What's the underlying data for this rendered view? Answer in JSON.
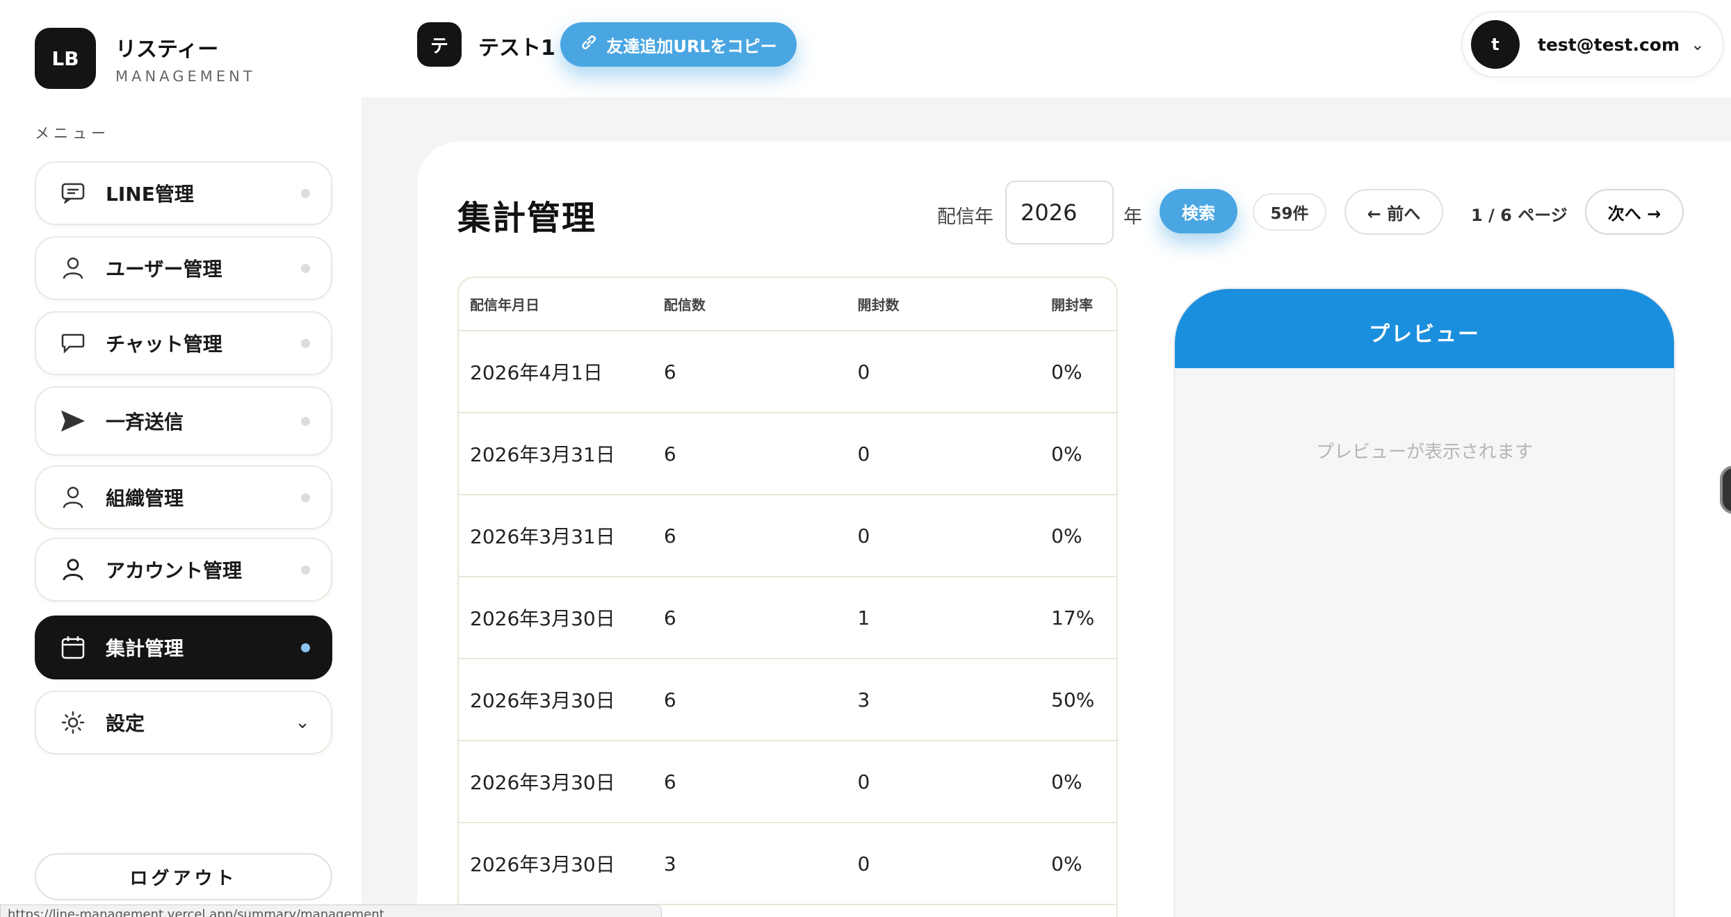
{
  "brand": {
    "logo": "LB",
    "name": "リスティー",
    "sub": "MANAGEMENT"
  },
  "menu_label": "メニュー",
  "sidebar": {
    "items": [
      {
        "label": "LINE管理",
        "icon": "message-square-icon",
        "active": false
      },
      {
        "label": "ユーザー管理",
        "icon": "user-icon",
        "active": false
      },
      {
        "label": "チャット管理",
        "icon": "chat-bubble-icon",
        "active": false
      },
      {
        "label": "一斉送信",
        "icon": "send-icon",
        "active": false
      },
      {
        "label": "組織管理",
        "icon": "user-icon",
        "active": false
      },
      {
        "label": "アカウント管理",
        "icon": "user-icon",
        "active": false
      },
      {
        "label": "集計管理",
        "icon": "calendar-icon",
        "active": true
      },
      {
        "label": "設定",
        "icon": "gear-icon",
        "active": false
      }
    ],
    "logout_label": "ログアウト"
  },
  "statusbar": {
    "url": "https://line-management.vercel.app/summary/management"
  },
  "topbar": {
    "account_initial": "テ",
    "account_name": "テスト1",
    "copy_button_label": "友達追加URLをコピー",
    "user_initial": "t",
    "user_email": "test@test.com"
  },
  "main": {
    "title": "集計管理",
    "year_label": "配信年",
    "year_value": "2026",
    "year_suffix": "年",
    "search_label": "検索",
    "count_label": "59件",
    "prev_label": "← 前へ",
    "page_info": "1 / 6 ページ",
    "next_label": "次へ →"
  },
  "table": {
    "headers": [
      "配信年月日",
      "配信数",
      "開封数",
      "開封率"
    ],
    "rows": [
      [
        "2026年4月1日",
        "6",
        "0",
        "0%"
      ],
      [
        "2026年3月31日",
        "6",
        "0",
        "0%"
      ],
      [
        "2026年3月31日",
        "6",
        "0",
        "0%"
      ],
      [
        "2026年3月30日",
        "6",
        "1",
        "17%"
      ],
      [
        "2026年3月30日",
        "6",
        "3",
        "50%"
      ],
      [
        "2026年3月30日",
        "6",
        "0",
        "0%"
      ],
      [
        "2026年3月30日",
        "3",
        "0",
        "0%"
      ]
    ]
  },
  "preview": {
    "header": "プレビュー",
    "empty_text": "プレビューが表示されます"
  },
  "colors": {
    "accent": "#4aa6e2",
    "preview_header": "#1a8fdd",
    "active_nav": "#141414",
    "active_dot": "#8cc4f0"
  }
}
